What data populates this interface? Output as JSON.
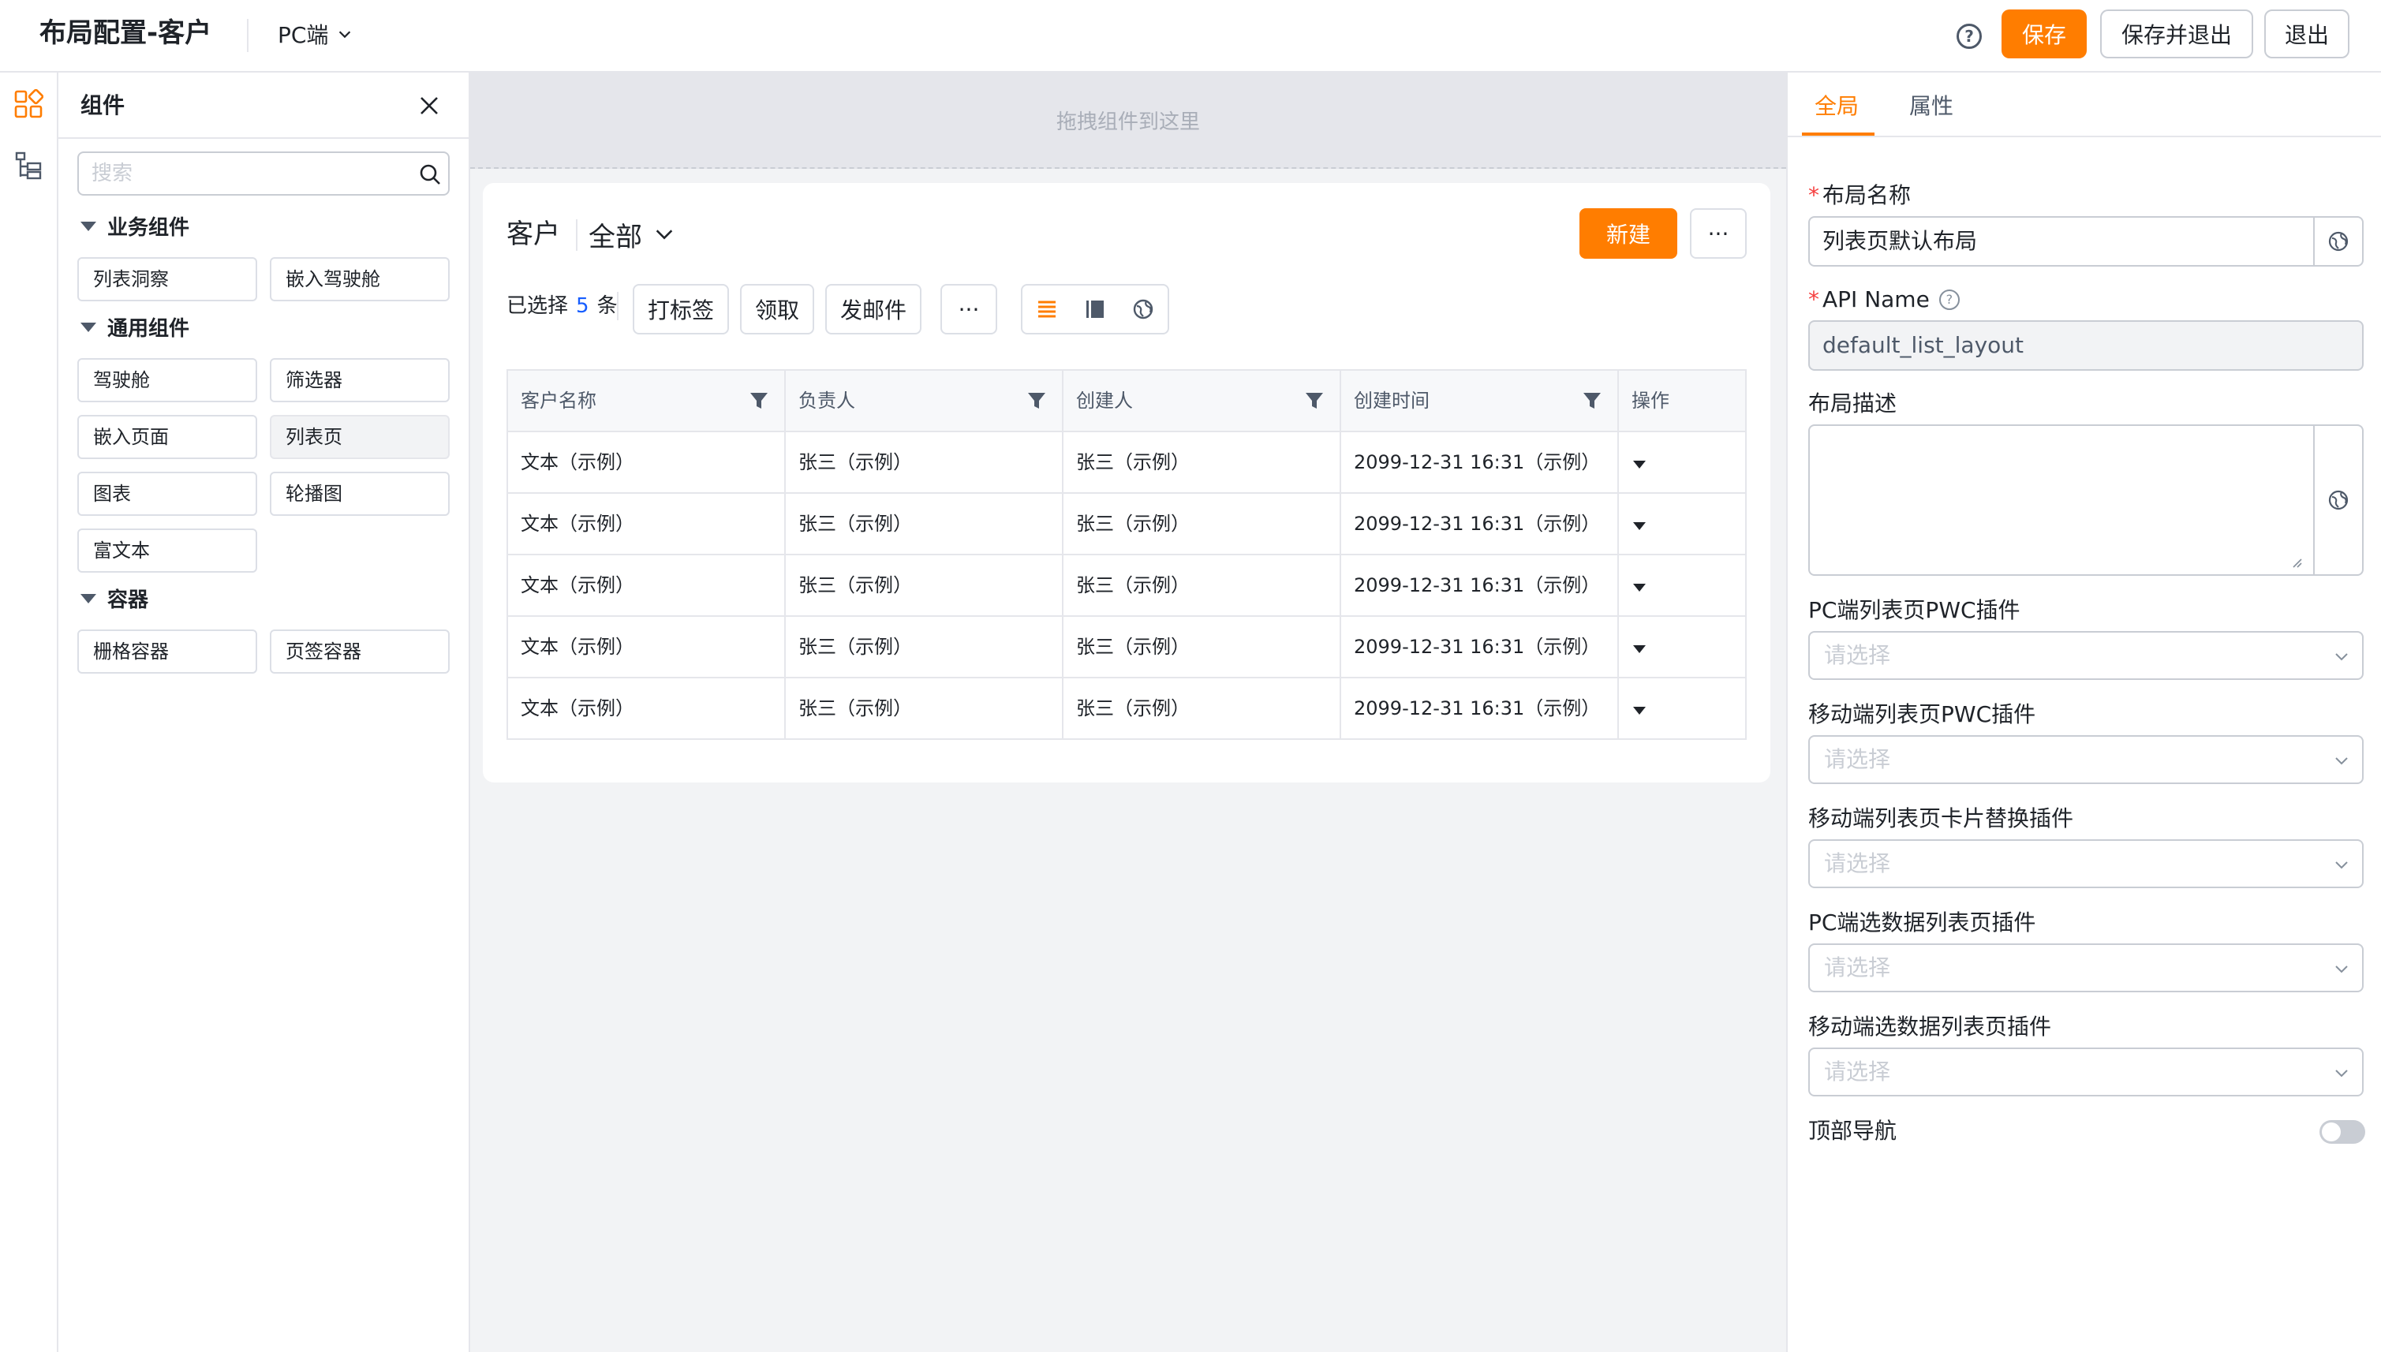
{
  "header": {
    "title": "布局配置-客户",
    "platform": "PC端",
    "help_icon": "?",
    "save_label": "保存",
    "save_exit_label": "保存并退出",
    "exit_label": "退出"
  },
  "rail": {
    "items": [
      {
        "icon": "components-grid-icon"
      },
      {
        "icon": "tree-structure-icon"
      }
    ]
  },
  "components_panel": {
    "title": "组件",
    "search_placeholder": "搜索",
    "groups": [
      {
        "title": "业务组件",
        "items": [
          "列表洞察",
          "嵌入驾驶舱"
        ]
      },
      {
        "title": "通用组件",
        "items": [
          "驾驶舱",
          "筛选器",
          "嵌入页面",
          "列表页",
          "图表",
          "轮播图",
          "富文本"
        ]
      },
      {
        "title": "容器",
        "items": [
          "栅格容器",
          "页签容器"
        ]
      }
    ],
    "active_item": "列表页"
  },
  "canvas": {
    "drop_hint": "拖拽组件到这里",
    "list": {
      "object_name": "客户",
      "view_name": "全部",
      "new_label": "新建",
      "more_label": "···",
      "selected_prefix": "已选择",
      "selected_count": "5",
      "selected_suffix": "条",
      "actions": [
        "打标签",
        "领取",
        "发邮件",
        "···"
      ],
      "view_modes": [
        "list-view-icon",
        "card-view-icon",
        "globe-icon"
      ],
      "columns": [
        "客户名称",
        "负责人",
        "创建人",
        "创建时间",
        "操作"
      ],
      "rows": [
        [
          "文本（示例）",
          "张三（示例）",
          "张三（示例）",
          "2099-12-31 16:31（示例）"
        ],
        [
          "文本（示例）",
          "张三（示例）",
          "张三（示例）",
          "2099-12-31 16:31（示例）"
        ],
        [
          "文本（示例）",
          "张三（示例）",
          "张三（示例）",
          "2099-12-31 16:31（示例）"
        ],
        [
          "文本（示例）",
          "张三（示例）",
          "张三（示例）",
          "2099-12-31 16:31（示例）"
        ],
        [
          "文本（示例）",
          "张三（示例）",
          "张三（示例）",
          "2099-12-31 16:31（示例）"
        ]
      ]
    }
  },
  "properties": {
    "tabs": [
      "全局",
      "属性"
    ],
    "active_tab": "全局",
    "layout_name_label": "布局名称",
    "layout_name_value": "列表页默认布局",
    "api_name_label": "API Name",
    "api_name_value": "default_list_layout",
    "description_label": "布局描述",
    "selects": [
      {
        "label": "PC端列表页PWC插件",
        "placeholder": "请选择"
      },
      {
        "label": "移动端列表页PWC插件",
        "placeholder": "请选择"
      },
      {
        "label": "移动端列表页卡片替换插件",
        "placeholder": "请选择"
      },
      {
        "label": "PC端选数据列表页插件",
        "placeholder": "请选择"
      },
      {
        "label": "移动端选数据列表页插件",
        "placeholder": "请选择"
      }
    ],
    "top_nav_label": "顶部导航",
    "top_nav_enabled": false
  },
  "colors": {
    "accent": "#ff7d00",
    "link": "#165dff",
    "required": "#f53f3f"
  }
}
